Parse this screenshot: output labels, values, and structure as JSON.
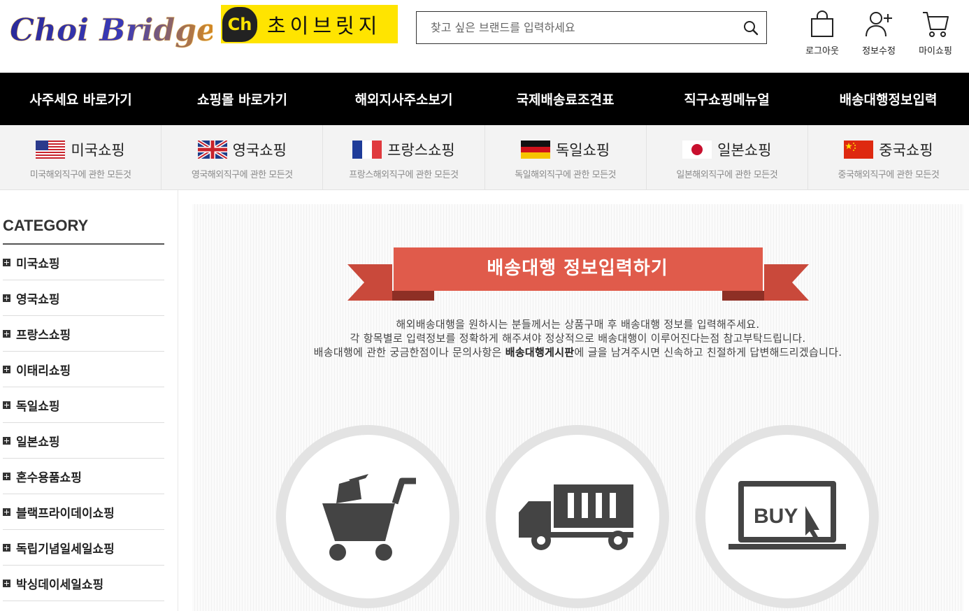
{
  "header": {
    "logo_text": "Choi Bridge",
    "banner_badge": "Ch",
    "banner_text": "초이브릿지",
    "search_placeholder": "찾고 싶은 브랜드를 입력하세요",
    "util": [
      {
        "label": "로그아웃",
        "icon": "shopping-bag-icon"
      },
      {
        "label": "정보수정",
        "icon": "user-add-icon"
      },
      {
        "label": "마이쇼핑",
        "icon": "cart-icon"
      }
    ]
  },
  "nav": [
    {
      "label": "사주세요 바로가기"
    },
    {
      "label": "쇼핑몰 바로가기"
    },
    {
      "label": "해외지사주소보기"
    },
    {
      "label": "국제배송료조견표"
    },
    {
      "label": "직구쇼핑메뉴얼"
    },
    {
      "label": "배송대행정보입력"
    }
  ],
  "countries": [
    {
      "name": "미국쇼핑",
      "sub": "미국해외직구에 관한 모든것",
      "flag": "us"
    },
    {
      "name": "영국쇼핑",
      "sub": "영국해외직구에 관한 모든것",
      "flag": "uk"
    },
    {
      "name": "프랑스쇼핑",
      "sub": "프랑스해외직구에 관한 모든것",
      "flag": "fr"
    },
    {
      "name": "독일쇼핑",
      "sub": "독일해외직구에 관한 모든것",
      "flag": "de"
    },
    {
      "name": "일본쇼핑",
      "sub": "일본해외직구에 관한 모든것",
      "flag": "jp"
    },
    {
      "name": "중국쇼핑",
      "sub": "중국해외직구에 관한 모든것",
      "flag": "cn"
    }
  ],
  "sidebar": {
    "title": "CATEGORY",
    "items": [
      {
        "label": "미국쇼핑"
      },
      {
        "label": "영국쇼핑"
      },
      {
        "label": "프랑스쇼핑"
      },
      {
        "label": "이태리쇼핑"
      },
      {
        "label": "독일쇼핑"
      },
      {
        "label": "일본쇼핑"
      },
      {
        "label": "혼수용품쇼핑"
      },
      {
        "label": "블랙프라이데이쇼핑"
      },
      {
        "label": "독립기념일세일쇼핑"
      },
      {
        "label": "박싱데이세일쇼핑"
      }
    ]
  },
  "main": {
    "ribbon_title": "배송대행 정보입력하기",
    "intro_line1": "해외배송대행을 원하시는 분들께서는 상품구매 후 배송대행 정보를 입력해주세요.",
    "intro_line2": "각 항목별로 입력정보를 정확하게 해주셔야 정상적으로 배송대행이 이루어진다는점 참고부탁드립니다.",
    "intro_line3_pre": "배송대행에 관한 궁금한점이나 문의사항은 ",
    "intro_line3_bold": "배송대행게시판",
    "intro_line3_post": "에 글을 남겨주시면 신속하고 친절하게 답변해드리겠습니다.",
    "steps": [
      {
        "icon": "shopping-cart-icon"
      },
      {
        "icon": "delivery-truck-icon"
      },
      {
        "icon": "laptop-buy-icon",
        "text": "BUY"
      }
    ]
  },
  "colors": {
    "nav_bg": "#000000",
    "banner_yellow": "#ffe400",
    "ribbon_red": "#e05b4b",
    "ribbon_dark": "#b84536",
    "icon_gray": "#444444"
  }
}
